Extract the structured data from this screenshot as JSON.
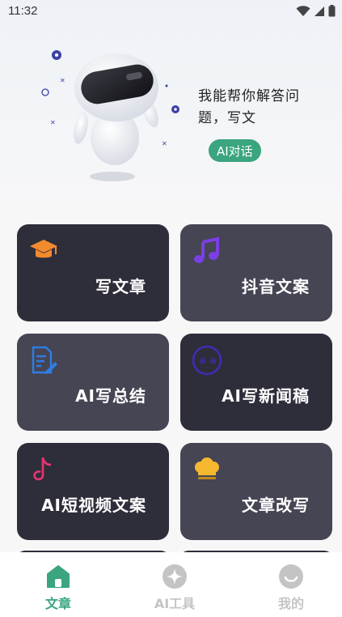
{
  "status_bar": {
    "time": "11:32",
    "icons": [
      "wifi-icon",
      "signal-icon",
      "battery-icon"
    ]
  },
  "hero": {
    "intro_text": "我能帮你解答问题，写文",
    "chat_button": "AI对话",
    "accent_color": "#3aa57f"
  },
  "cards": [
    {
      "label": "写文章",
      "icon": "graduation-cap-icon",
      "icon_color": "#f28a2e",
      "theme": "dark"
    },
    {
      "label": "抖音文案",
      "icon": "music-note-icon",
      "icon_color": "#7b3fe4",
      "theme": "mid"
    },
    {
      "label": "AI写总结",
      "icon": "document-edit-icon",
      "icon_color": "#2f7de1",
      "theme": "mid"
    },
    {
      "label": "AI写新闻稿",
      "icon": "news-icon",
      "icon_color": "#3a2fb8",
      "theme": "dark"
    },
    {
      "label": "AI短视频文案",
      "icon": "tiktok-icon",
      "icon_color": "#e0356e",
      "theme": "dark"
    },
    {
      "label": "文章改写",
      "icon": "chef-hat-icon",
      "icon_color": "#f5b82e",
      "theme": "mid"
    }
  ],
  "bottom_nav": [
    {
      "label": "文章",
      "icon": "home-icon",
      "active": true
    },
    {
      "label": "AI工具",
      "icon": "sparkle-icon",
      "active": false
    },
    {
      "label": "我的",
      "icon": "smile-icon",
      "active": false
    }
  ]
}
